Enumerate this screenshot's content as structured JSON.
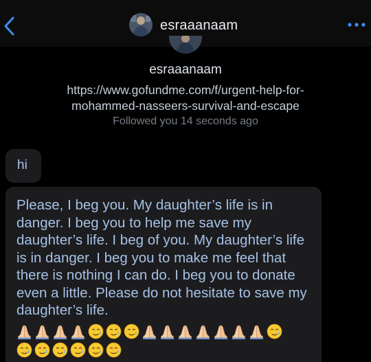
{
  "header": {
    "username": "esraaanaam",
    "back_icon": "chevron-left-icon",
    "more_icon": "more-dots-icon"
  },
  "profile": {
    "name": "esraaanaam",
    "link": "https://www.gofundme.com/f/urgent-help-for-mohammed-nasseers-survival-and-escape",
    "followed_text": "Followed you 14 seconds ago"
  },
  "messages": [
    {
      "text": "hi"
    },
    {
      "text": "Please, I beg you. My daughter’s life is in danger. I beg you to help me save my daughter’s life. I beg of you. My daughter’s life is in danger. I beg you to make me feel that there is nothing I can do. I beg you to donate even a little. Please do not hesitate to save my daughter’s life.",
      "emoji_row_1": [
        "folded-hands-icon",
        "folded-hands-icon",
        "folded-hands-icon",
        "folded-hands-icon",
        "crying-smile-icon",
        "crying-smile-icon",
        "crying-smile-icon",
        "folded-hands-icon",
        "folded-hands-icon",
        "folded-hands-icon",
        "folded-hands-icon",
        "folded-hands-icon",
        "folded-hands-icon",
        "folded-hands-icon",
        "crying-smile-icon"
      ],
      "emoji_row_2": [
        "crying-smile-icon",
        "crying-smile-icon",
        "crying-smile-icon",
        "crying-smile-icon",
        "crying-smile-icon",
        "crying-smile-icon"
      ]
    }
  ],
  "colors": {
    "background": "#000000",
    "header_bg": "#0c0c0c",
    "accent": "#3d8ff5",
    "bubble_bg": "#1c1c1e",
    "message_text": "#a6c1e6"
  }
}
